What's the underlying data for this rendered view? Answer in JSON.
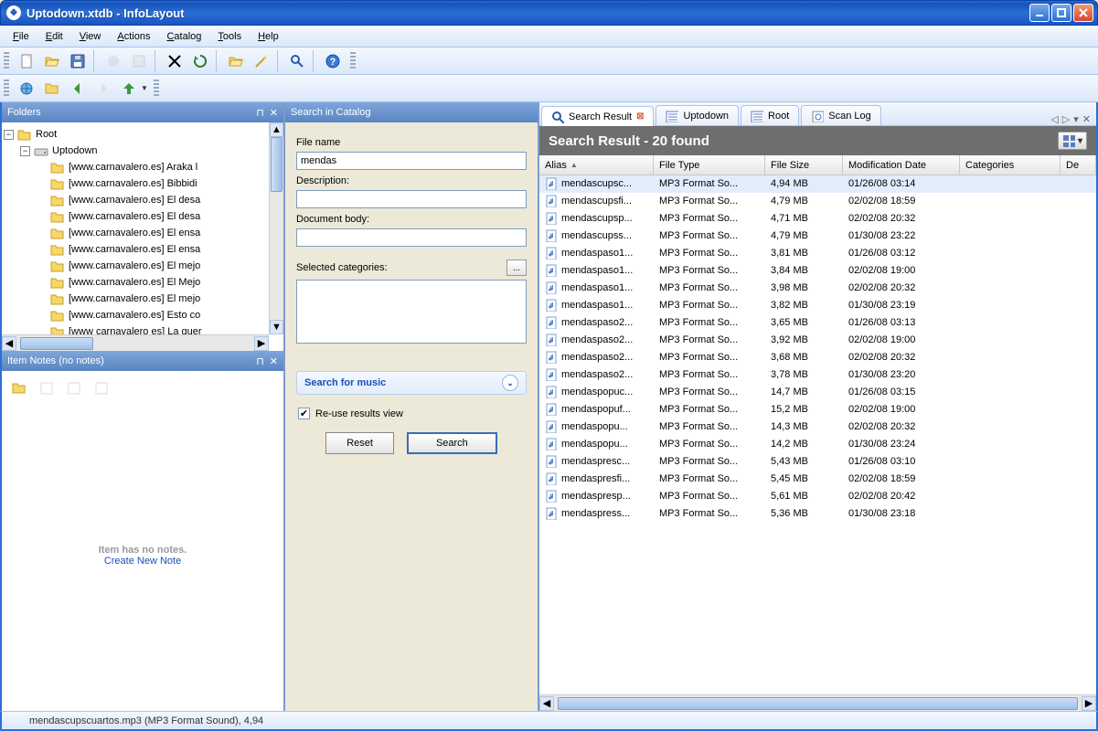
{
  "window": {
    "title": "Uptodown.xtdb - InfoLayout"
  },
  "menu": [
    "File",
    "Edit",
    "View",
    "Actions",
    "Catalog",
    "Tools",
    "Help"
  ],
  "panel": {
    "folders": "Folders",
    "search": "Search in Catalog",
    "notes": "Item Notes (no notes)"
  },
  "tree": {
    "root": "Root",
    "drive": "Uptodown",
    "items": [
      "[www.carnavalero.es] Araka l",
      "[www.carnavalero.es] Bibbidi",
      "[www.carnavalero.es] El desa",
      "[www.carnavalero.es] El desa",
      "[www.carnavalero.es] El ensa",
      "[www.carnavalero.es] El ensa",
      "[www.carnavalero.es] El mejo",
      "[www.carnavalero.es] El Mejo",
      "[www.carnavalero.es] El mejo",
      "[www.carnavalero.es] Esto co",
      "[www carnavalero es] La quer"
    ]
  },
  "search": {
    "file_name_label": "File name",
    "file_name_value": "mendas",
    "description_label": "Description:",
    "body_label": "Document body:",
    "categories_label": "Selected categories:",
    "browse": "...",
    "music_header": "Search for music",
    "reuse": "Re-use results view",
    "reset": "Reset",
    "go": "Search"
  },
  "notes": {
    "empty": "Item has no notes.",
    "create": "Create New Note"
  },
  "tabs": [
    {
      "label": "Search Result",
      "closeable": true,
      "active": true,
      "icon": "search"
    },
    {
      "label": "Uptodown",
      "closeable": false,
      "active": false,
      "icon": "list"
    },
    {
      "label": "Root",
      "closeable": false,
      "active": false,
      "icon": "list"
    },
    {
      "label": "Scan Log",
      "closeable": false,
      "active": false,
      "icon": "log"
    }
  ],
  "results": {
    "header": "Search Result - 20 found",
    "columns": [
      "Alias",
      "File Type",
      "File Size",
      "Modification Date",
      "Categories",
      "De"
    ],
    "rows": [
      {
        "alias": "mendascupsc...",
        "type": "MP3 Format So...",
        "size": "4,94 MB",
        "mod": "01/26/08 03:14"
      },
      {
        "alias": "mendascupsfi...",
        "type": "MP3 Format So...",
        "size": "4,79 MB",
        "mod": "02/02/08 18:59"
      },
      {
        "alias": "mendascupsp...",
        "type": "MP3 Format So...",
        "size": "4,71 MB",
        "mod": "02/02/08 20:32"
      },
      {
        "alias": "mendascupss...",
        "type": "MP3 Format So...",
        "size": "4,79 MB",
        "mod": "01/30/08 23:22"
      },
      {
        "alias": "mendaspaso1...",
        "type": "MP3 Format So...",
        "size": "3,81 MB",
        "mod": "01/26/08 03:12"
      },
      {
        "alias": "mendaspaso1...",
        "type": "MP3 Format So...",
        "size": "3,84 MB",
        "mod": "02/02/08 19:00"
      },
      {
        "alias": "mendaspaso1...",
        "type": "MP3 Format So...",
        "size": "3,98 MB",
        "mod": "02/02/08 20:32"
      },
      {
        "alias": "mendaspaso1...",
        "type": "MP3 Format So...",
        "size": "3,82 MB",
        "mod": "01/30/08 23:19"
      },
      {
        "alias": "mendaspaso2...",
        "type": "MP3 Format So...",
        "size": "3,65 MB",
        "mod": "01/26/08 03:13"
      },
      {
        "alias": "mendaspaso2...",
        "type": "MP3 Format So...",
        "size": "3,92 MB",
        "mod": "02/02/08 19:00"
      },
      {
        "alias": "mendaspaso2...",
        "type": "MP3 Format So...",
        "size": "3,68 MB",
        "mod": "02/02/08 20:32"
      },
      {
        "alias": "mendaspaso2...",
        "type": "MP3 Format So...",
        "size": "3,78 MB",
        "mod": "01/30/08 23:20"
      },
      {
        "alias": "mendaspopuc...",
        "type": "MP3 Format So...",
        "size": "14,7 MB",
        "mod": "01/26/08 03:15"
      },
      {
        "alias": "mendaspopuf...",
        "type": "MP3 Format So...",
        "size": "15,2 MB",
        "mod": "02/02/08 19:00"
      },
      {
        "alias": "mendaspopu...",
        "type": "MP3 Format So...",
        "size": "14,3 MB",
        "mod": "02/02/08 20:32"
      },
      {
        "alias": "mendaspopu...",
        "type": "MP3 Format So...",
        "size": "14,2 MB",
        "mod": "01/30/08 23:24"
      },
      {
        "alias": "mendaspresc...",
        "type": "MP3 Format So...",
        "size": "5,43 MB",
        "mod": "01/26/08 03:10"
      },
      {
        "alias": "mendaspresfi...",
        "type": "MP3 Format So...",
        "size": "5,45 MB",
        "mod": "02/02/08 18:59"
      },
      {
        "alias": "mendaspresp...",
        "type": "MP3 Format So...",
        "size": "5,61 MB",
        "mod": "02/02/08 20:42"
      },
      {
        "alias": "mendaspress...",
        "type": "MP3 Format So...",
        "size": "5,36 MB",
        "mod": "01/30/08 23:18"
      }
    ]
  },
  "status": "mendascupscuartos.mp3 (MP3 Format Sound), 4,94"
}
